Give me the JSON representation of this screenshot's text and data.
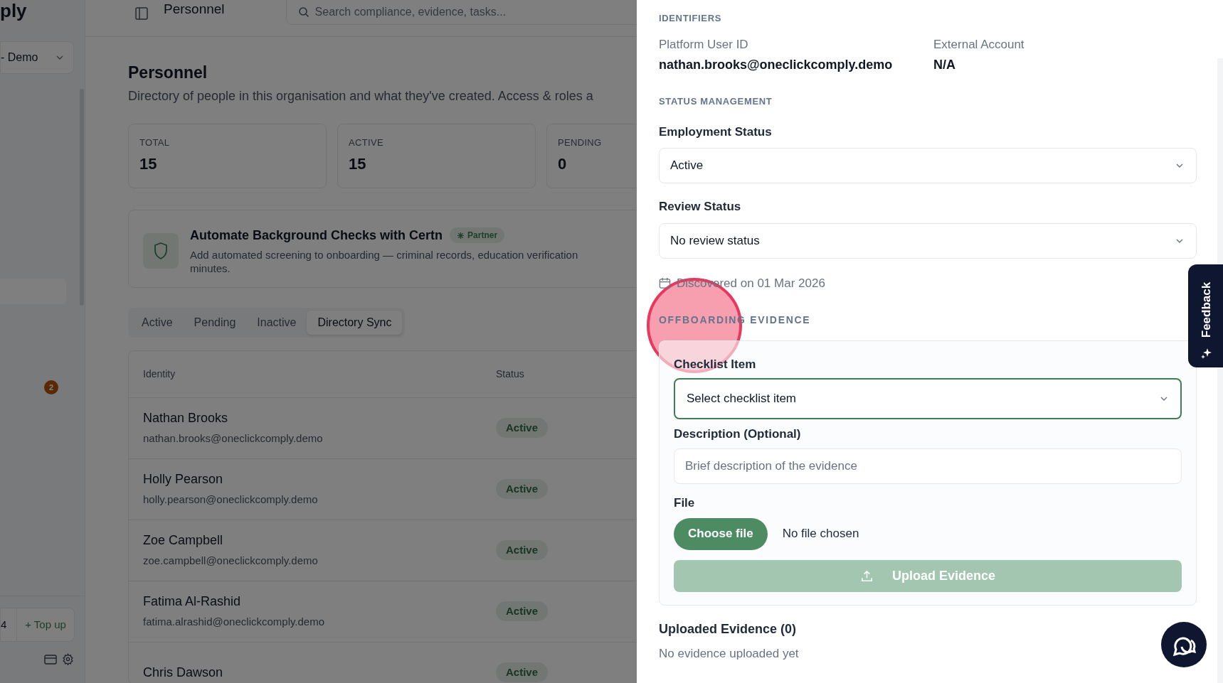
{
  "sidebar": {
    "brand": "ply",
    "workspace": "- Demo",
    "badge": "2",
    "credits": "4",
    "top_up": "+ Top up"
  },
  "header": {
    "title": "Personnel",
    "search_placeholder": "Search compliance, evidence, tasks..."
  },
  "page": {
    "title": "Personnel",
    "description": "Directory of people in this organisation and what they've created. Access & roles a"
  },
  "stats": [
    {
      "label": "TOTAL",
      "value": "15"
    },
    {
      "label": "ACTIVE",
      "value": "15"
    },
    {
      "label": "PENDING",
      "value": "0"
    }
  ],
  "promo": {
    "title": "Automate Background Checks with Certn",
    "badge": "Partner",
    "text_lines": [
      "Add automated screening to onboarding — criminal records, education verification",
      "minutes."
    ]
  },
  "tabs": [
    {
      "label": "Active",
      "selected": false
    },
    {
      "label": "Pending",
      "selected": false
    },
    {
      "label": "Inactive",
      "selected": false
    },
    {
      "label": "Directory Sync",
      "selected": true
    }
  ],
  "table": {
    "columns": [
      "Identity",
      "Status"
    ],
    "rows": [
      {
        "name": "Nathan Brooks",
        "email": "nathan.brooks@oneclickcomply.demo",
        "status": "Active"
      },
      {
        "name": "Holly Pearson",
        "email": "holly.pearson@oneclickcomply.demo",
        "status": "Active"
      },
      {
        "name": "Zoe Campbell",
        "email": "zoe.campbell@oneclickcomply.demo",
        "status": "Active"
      },
      {
        "name": "Fatima Al-Rashid",
        "email": "fatima.alrashid@oneclickcomply.demo",
        "status": "Active"
      },
      {
        "name": "Chris Dawson",
        "status": "Active"
      }
    ]
  },
  "drawer": {
    "identifiers": {
      "heading": "IDENTIFIERS",
      "fields": [
        {
          "label": "Platform User ID",
          "value": "nathan.brooks@oneclickcomply.demo"
        },
        {
          "label": "External Account",
          "value": "N/A"
        }
      ]
    },
    "status_management": {
      "heading": "STATUS MANAGEMENT",
      "selects": [
        {
          "label": "Employment Status",
          "value": "Active"
        },
        {
          "label": "Review Status",
          "value": "No review status"
        }
      ],
      "discovered": "Discovered on 01 Mar 2026"
    },
    "evidence": {
      "heading": "OFFBOARDING EVIDENCE",
      "checklist_label": "Checklist Item",
      "checklist_value": "Select checklist item",
      "description_label": "Description (Optional)",
      "description_placeholder": "Brief description of the evidence",
      "file_label": "File",
      "choose_button": "Choose file",
      "file_status": "No file chosen",
      "upload_button": "Upload Evidence",
      "upload_disabled": true
    },
    "uploaded_heading": "Uploaded Evidence (0)",
    "uploaded_empty": "No evidence uploaded yet"
  },
  "feedback_tab": "Feedback"
}
